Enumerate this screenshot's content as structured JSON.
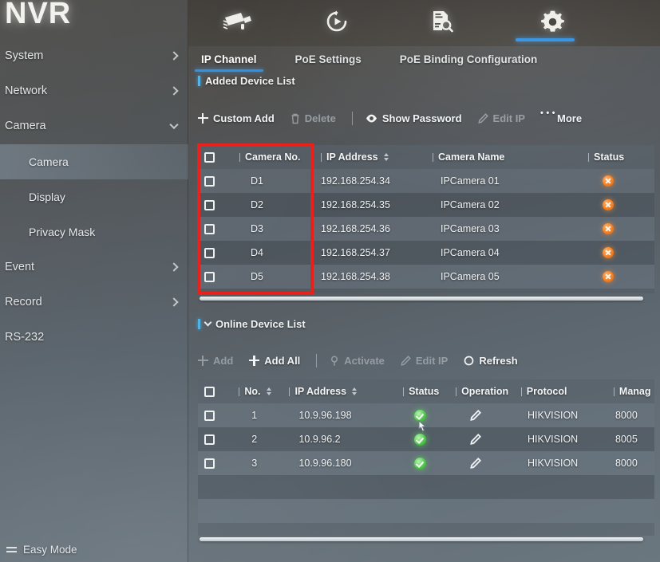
{
  "app": {
    "logo": "NVR",
    "easy_mode_label": "Easy Mode"
  },
  "topbar": {
    "icons": [
      {
        "name": "camera-icon",
        "label": "Camera"
      },
      {
        "name": "playback-icon",
        "label": "Playback"
      },
      {
        "name": "log-search-icon",
        "label": "Log Search"
      },
      {
        "name": "settings-gear-icon",
        "label": "Settings"
      }
    ],
    "active_index": 3
  },
  "sidebar": {
    "items": [
      {
        "label": "System",
        "expandable": true,
        "expanded": false
      },
      {
        "label": "Network",
        "expandable": true,
        "expanded": false
      },
      {
        "label": "Camera",
        "expandable": true,
        "expanded": true
      },
      {
        "label": "Event",
        "expandable": true,
        "expanded": false
      },
      {
        "label": "Record",
        "expandable": true,
        "expanded": false
      },
      {
        "label": "RS-232",
        "expandable": false,
        "expanded": false
      }
    ],
    "camera_subitems": [
      {
        "label": "Camera",
        "active": true
      },
      {
        "label": "Display",
        "active": false
      },
      {
        "label": "Privacy Mask",
        "active": false
      }
    ]
  },
  "tabs": [
    {
      "label": "IP Channel",
      "active": true
    },
    {
      "label": "PoE Settings",
      "active": false
    },
    {
      "label": "PoE Binding Configuration",
      "active": false
    }
  ],
  "added_device_list": {
    "section_title": "Added Device List",
    "toolbar": [
      {
        "label": "Custom Add",
        "icon": "plus-icon",
        "disabled": false
      },
      {
        "label": "Delete",
        "icon": "trash-icon",
        "disabled": true
      },
      {
        "label": "Show Password",
        "icon": "eye-icon",
        "disabled": false
      },
      {
        "label": "Edit IP",
        "icon": "pencil-icon",
        "disabled": true
      },
      {
        "label": "More",
        "icon": "ellipsis-icon",
        "disabled": false
      }
    ],
    "columns": [
      "Camera No.",
      "IP Address",
      "Camera Name",
      "Status"
    ],
    "sort_column": "IP Address",
    "rows": [
      {
        "camera_no": "D1",
        "ip_address": "192.168.254.34",
        "camera_name": "IPCamera 01",
        "status": "error"
      },
      {
        "camera_no": "D2",
        "ip_address": "192.168.254.35",
        "camera_name": "IPCamera 02",
        "status": "error"
      },
      {
        "camera_no": "D3",
        "ip_address": "192.168.254.36",
        "camera_name": "IPCamera 03",
        "status": "error"
      },
      {
        "camera_no": "D4",
        "ip_address": "192.168.254.37",
        "camera_name": "IPCamera 04",
        "status": "error"
      },
      {
        "camera_no": "D5",
        "ip_address": "192.168.254.38",
        "camera_name": "IPCamera 05",
        "status": "error"
      }
    ]
  },
  "online_device_list": {
    "section_title": "Online Device List",
    "toolbar": [
      {
        "label": "Add",
        "icon": "plus-icon",
        "disabled": true
      },
      {
        "label": "Add All",
        "icon": "plus-icon",
        "disabled": false
      },
      {
        "label": "Activate",
        "icon": "key-icon",
        "disabled": true
      },
      {
        "label": "Edit IP",
        "icon": "pencil-icon",
        "disabled": true
      },
      {
        "label": "Refresh",
        "icon": "refresh-icon",
        "disabled": false
      }
    ],
    "columns": [
      "No.",
      "IP Address",
      "Status",
      "Operation",
      "Manag"
    ],
    "protocol_column": "Protocol",
    "rows": [
      {
        "no": "1",
        "ip_address": "10.9.96.198",
        "status": "ok",
        "protocol": "HIKVISION",
        "manage_port": "8000"
      },
      {
        "no": "2",
        "ip_address": "10.9.96.2",
        "status": "ok",
        "protocol": "HIKVISION",
        "manage_port": "8005"
      },
      {
        "no": "3",
        "ip_address": "10.9.96.180",
        "status": "ok",
        "protocol": "HIKVISION",
        "manage_port": "8000"
      }
    ]
  },
  "annotation": {
    "color": "#e8201c",
    "target": "camera-no-column"
  }
}
